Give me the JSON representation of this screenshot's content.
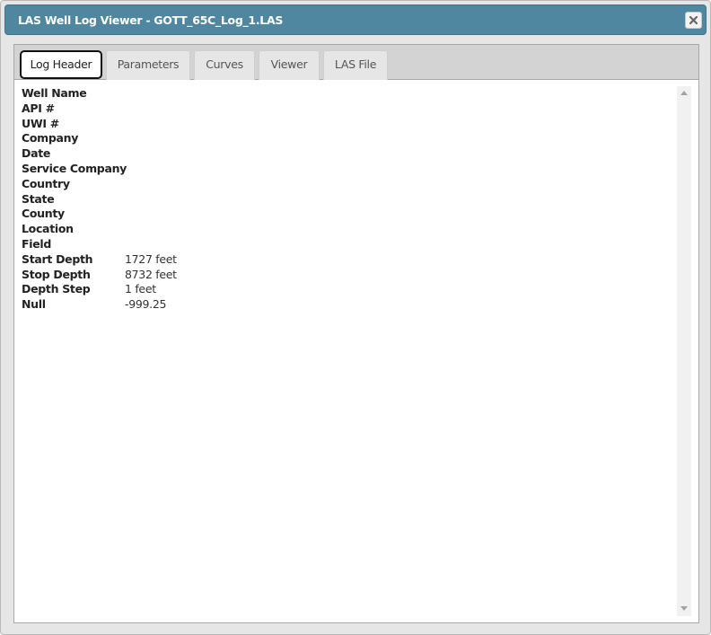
{
  "window": {
    "title": "LAS Well Log Viewer - GOTT_65C_Log_1.LAS",
    "close_icon": "close-icon"
  },
  "tabs": [
    {
      "label": "Log Header",
      "active": true
    },
    {
      "label": "Parameters",
      "active": false
    },
    {
      "label": "Curves",
      "active": false
    },
    {
      "label": "Viewer",
      "active": false
    },
    {
      "label": "LAS File",
      "active": false
    }
  ],
  "header_fields": [
    {
      "label": "Well Name",
      "value": ""
    },
    {
      "label": "API #",
      "value": ""
    },
    {
      "label": "UWI #",
      "value": ""
    },
    {
      "label": "Company",
      "value": ""
    },
    {
      "label": "Date",
      "value": ""
    },
    {
      "label": "Service Company",
      "value": ""
    },
    {
      "label": "Country",
      "value": ""
    },
    {
      "label": "State",
      "value": ""
    },
    {
      "label": "County",
      "value": ""
    },
    {
      "label": "Location",
      "value": ""
    },
    {
      "label": "Field",
      "value": ""
    },
    {
      "label": "Start Depth",
      "value": "1727 feet"
    },
    {
      "label": "Stop Depth",
      "value": "8732 feet"
    },
    {
      "label": "Depth Step",
      "value": "1 feet"
    },
    {
      "label": "Null",
      "value": "-999.25"
    }
  ],
  "colors": {
    "titlebar": "#4f87a0",
    "tabbar": "#d3d3d3",
    "active_tab_border": "#111111"
  }
}
